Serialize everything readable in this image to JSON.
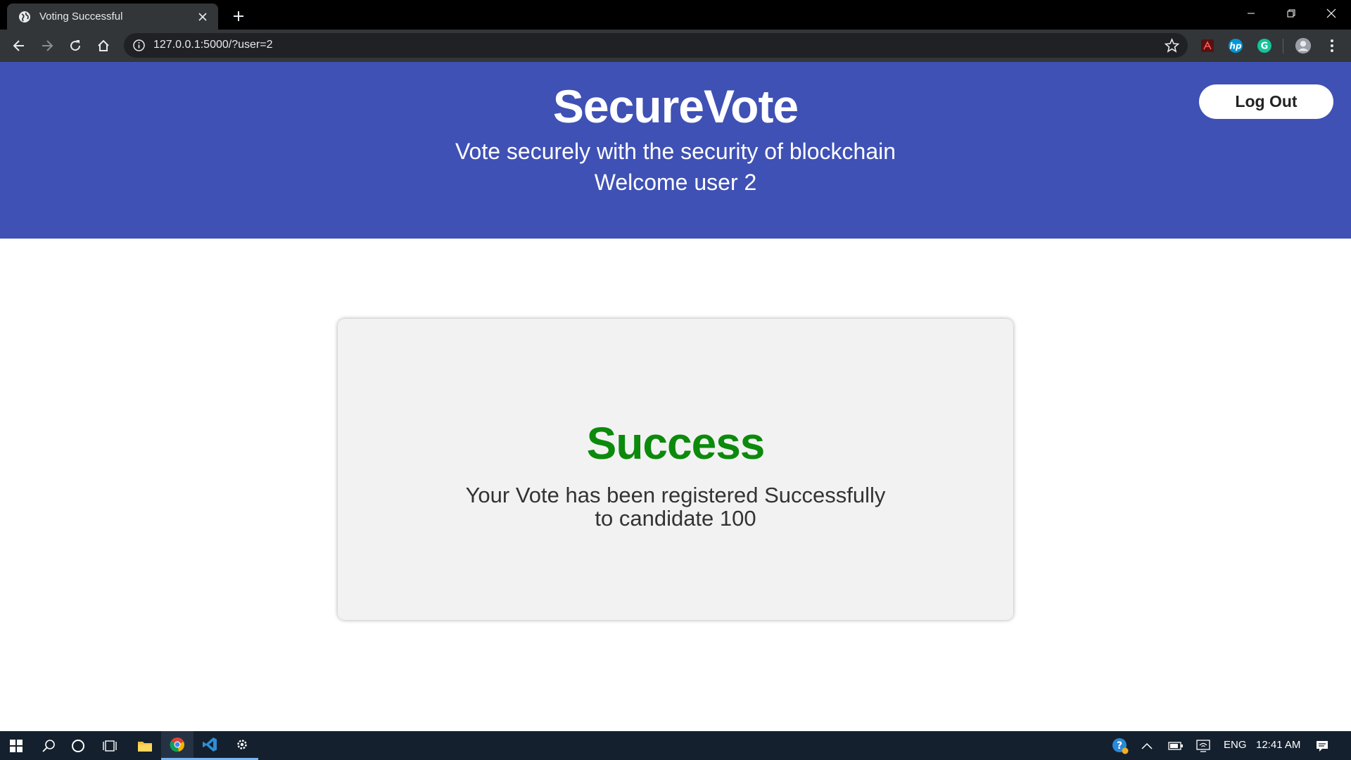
{
  "browser": {
    "tab_title": "Voting Successful",
    "url": "127.0.0.1:5000/?user=2"
  },
  "header": {
    "title": "SecureVote",
    "subtitle": "Vote securely with the security of blockchain",
    "welcome": "Welcome user 2",
    "logout_label": "Log Out"
  },
  "card": {
    "heading": "Success",
    "message_line1": "Your Vote has been registered Successfully",
    "message_line2": "to candidate 100"
  },
  "taskbar": {
    "language": "ENG",
    "time": "12:41 AM"
  },
  "colors": {
    "header_bg": "#3f51b5",
    "success_green": "#0c8a0c",
    "card_bg": "#f2f2f2"
  }
}
